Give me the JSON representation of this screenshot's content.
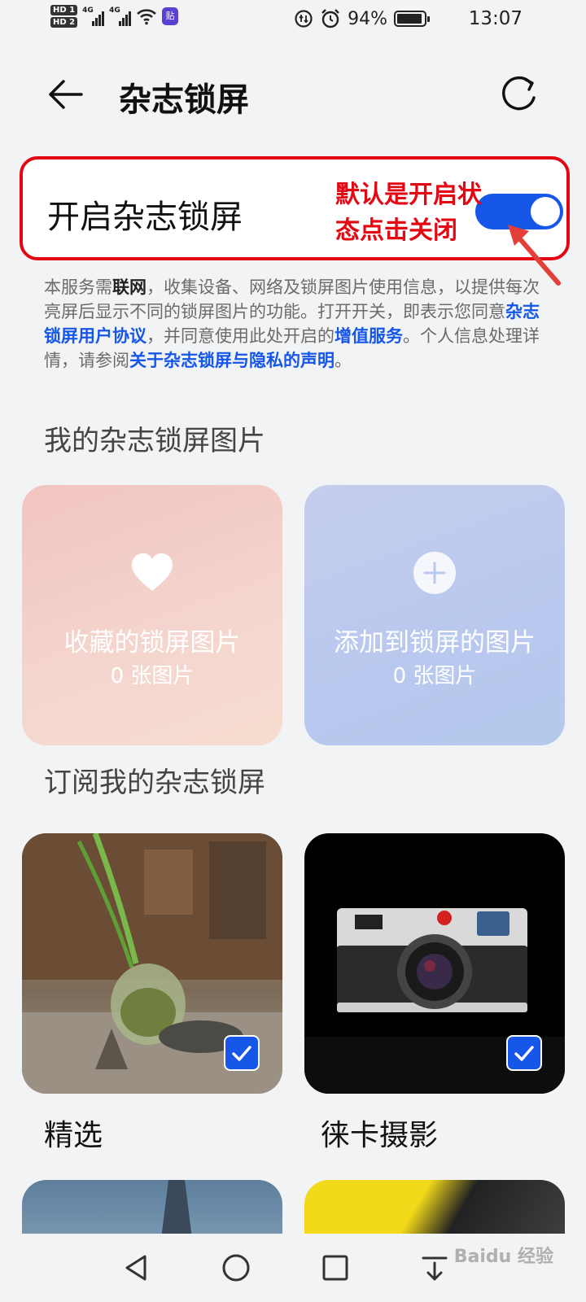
{
  "status_bar": {
    "hd1": "HD 1",
    "hd2": "HD 2",
    "net1": "4G",
    "net2": "4G",
    "sticker_icon": "贴",
    "battery_pct": "94%",
    "battery_level": 0.94,
    "time": "13:07"
  },
  "header": {
    "title": "杂志锁屏"
  },
  "toggle": {
    "label": "开启杂志锁屏",
    "on": true,
    "annotation_line1": "默认是开启状",
    "annotation_line2": "态点击关闭"
  },
  "description": {
    "p1": "本服务需",
    "p2": "联网",
    "p3": "，收集设备、网络及锁屏图片使用信息，以提供每次亮屏后显示不同的锁屏图片的功能。打开开关，即表示您同意",
    "link1": "杂志锁屏用户协议",
    "p4": "，并同意使用此处开启的",
    "link2": "增值服务",
    "p5": "。个人信息处理详情，请参阅",
    "link3": "关于杂志锁屏与隐私的声明",
    "p6": "。"
  },
  "my_pictures": {
    "title": "我的杂志锁屏图片",
    "favorites": {
      "title": "收藏的锁屏图片",
      "count": "0 张图片",
      "icon": "heart-icon"
    },
    "added": {
      "title": "添加到锁屏的图片",
      "count": "0 张图片",
      "icon": "plus-icon"
    }
  },
  "subscriptions": {
    "title": "订阅我的杂志锁屏",
    "items": [
      {
        "label": "精选",
        "checked": true
      },
      {
        "label": "徕卡摄影",
        "checked": true
      }
    ]
  },
  "watermark": "Baidu 经验"
}
